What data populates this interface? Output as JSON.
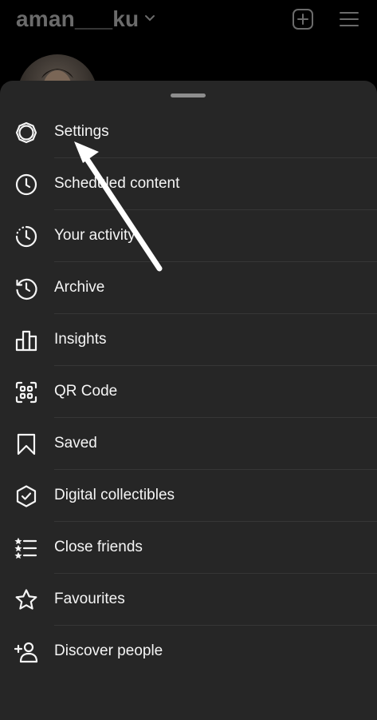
{
  "header": {
    "username": "aman___ku",
    "icons": {
      "dropdown": "chevron-down-icon",
      "create": "plus-square-icon",
      "menu": "hamburger-menu-icon"
    }
  },
  "profile": {
    "avatar": "profile-avatar"
  },
  "menu": {
    "items": [
      {
        "label": "Settings",
        "icon": "gear-icon"
      },
      {
        "label": "Scheduled content",
        "icon": "clock-icon"
      },
      {
        "label": "Your activity",
        "icon": "activity-icon"
      },
      {
        "label": "Archive",
        "icon": "archive-icon"
      },
      {
        "label": "Insights",
        "icon": "insights-icon"
      },
      {
        "label": "QR Code",
        "icon": "qr-code-icon"
      },
      {
        "label": "Saved",
        "icon": "bookmark-icon"
      },
      {
        "label": "Digital collectibles",
        "icon": "shield-check-icon"
      },
      {
        "label": "Close friends",
        "icon": "close-friends-icon"
      },
      {
        "label": "Favourites",
        "icon": "star-icon"
      },
      {
        "label": "Discover people",
        "icon": "add-person-icon"
      }
    ]
  },
  "annotation": {
    "type": "pointer-arrow",
    "target": "Settings"
  },
  "colors": {
    "background": "#000000",
    "sheet": "#262626",
    "text": "#f5f5f5",
    "muted": "#6b6b6b",
    "divider": "#363636"
  }
}
